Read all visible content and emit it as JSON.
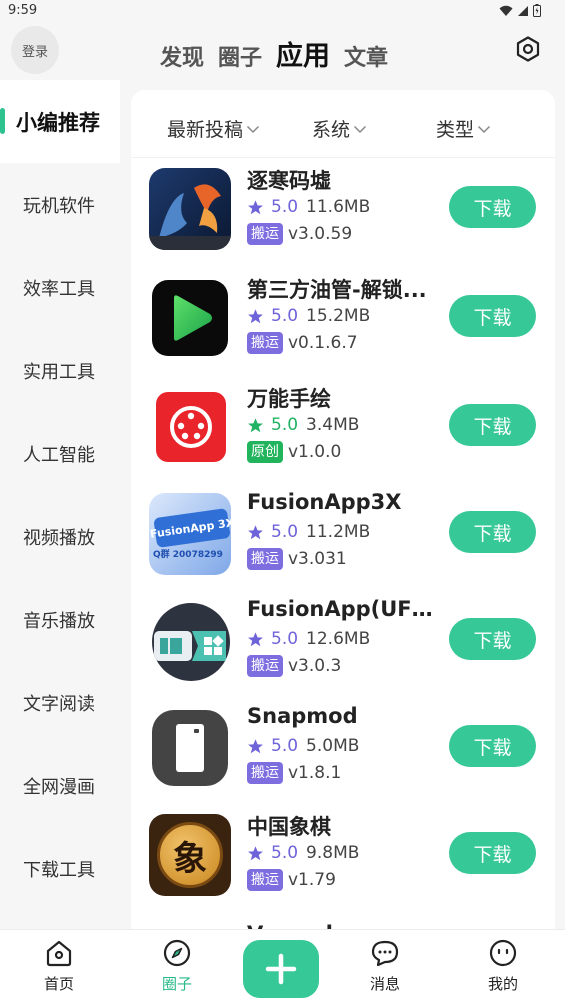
{
  "status_bar": {
    "time": "9:59"
  },
  "header": {
    "login_label": "登录",
    "tabs": [
      {
        "label": "发现"
      },
      {
        "label": "圈子"
      },
      {
        "label": "应用"
      },
      {
        "label": "文章"
      }
    ],
    "active_tab": "应用"
  },
  "sidebar": {
    "items": [
      {
        "label": "小编推荐"
      },
      {
        "label": "玩机软件"
      },
      {
        "label": "效率工具"
      },
      {
        "label": "实用工具"
      },
      {
        "label": "人工智能"
      },
      {
        "label": "视频播放"
      },
      {
        "label": "音乐播放"
      },
      {
        "label": "文字阅读"
      },
      {
        "label": "全网漫画"
      },
      {
        "label": "下载工具"
      }
    ],
    "active": "小编推荐"
  },
  "filters": [
    {
      "label": "最新投稿"
    },
    {
      "label": "系统"
    },
    {
      "label": "类型"
    }
  ],
  "apps": [
    {
      "name": "逐寒码墟",
      "rating": "5.0",
      "size": "11.6MB",
      "badge": "搬运",
      "version": "v3.0.59",
      "button": "下载"
    },
    {
      "name": "第三方油管-解锁...",
      "rating": "5.0",
      "size": "15.2MB",
      "badge": "搬运",
      "version": "v0.1.6.7",
      "button": "下载"
    },
    {
      "name": "万能手绘",
      "rating": "5.0",
      "size": "3.4MB",
      "badge": "原创",
      "version": "v1.0.0",
      "button": "下载"
    },
    {
      "name": "FusionApp3X",
      "rating": "5.0",
      "size": "11.2MB",
      "badge": "搬运",
      "version": "v3.031",
      "button": "下载",
      "icon_text": "FusionApp 3X",
      "icon_subtext": "Q群 20078299"
    },
    {
      "name": "FusionApp(UFO...",
      "rating": "5.0",
      "size": "12.6MB",
      "badge": "搬运",
      "version": "v3.0.3",
      "button": "下载"
    },
    {
      "name": "Snapmod",
      "rating": "5.0",
      "size": "5.0MB",
      "badge": "搬运",
      "version": "v1.8.1",
      "button": "下载"
    },
    {
      "name": "中国象棋",
      "rating": "5.0",
      "size": "9.8MB",
      "badge": "搬运",
      "version": "v1.79",
      "button": "下载",
      "icon_text": "象"
    }
  ],
  "partial_next_app": "Vanced",
  "bottom_nav": {
    "items": [
      {
        "label": "首页"
      },
      {
        "label": "圈子"
      },
      {
        "label": "消息"
      },
      {
        "label": "我的"
      }
    ],
    "active": "圈子"
  },
  "colors": {
    "accent": "#36c896",
    "badge_purple": "#7d6ee0",
    "badge_green": "#22b45c",
    "star_purple": "#6e63d8",
    "star_green": "#20b363"
  }
}
